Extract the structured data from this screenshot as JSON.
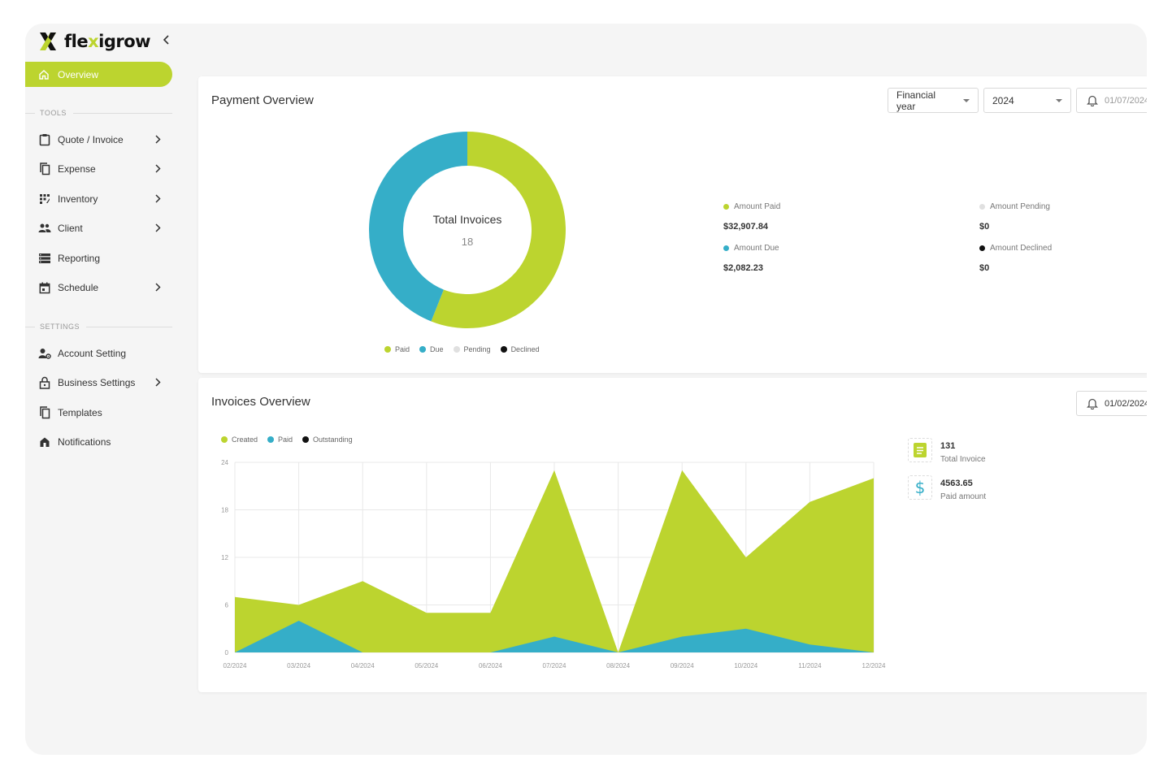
{
  "brand": {
    "name_prefix": "fle",
    "name_x": "x",
    "name_suffix": "igrow",
    "color": "#bcd42f"
  },
  "sidebar": {
    "active": {
      "label": "Overview",
      "icon": "home-icon"
    },
    "tools_heading": "TOOLS",
    "tools": [
      {
        "label": "Quote / Invoice",
        "icon": "clipboard-icon",
        "has_submenu": true
      },
      {
        "label": "Expense",
        "icon": "copy-icon",
        "has_submenu": true
      },
      {
        "label": "Inventory",
        "icon": "grid-icon",
        "has_submenu": true
      },
      {
        "label": "Client",
        "icon": "people-icon",
        "has_submenu": true
      },
      {
        "label": "Reporting",
        "icon": "storage-icon",
        "has_submenu": false
      },
      {
        "label": "Schedule",
        "icon": "calendar-icon",
        "has_submenu": true
      }
    ],
    "settings_heading": "SETTINGS",
    "settings": [
      {
        "label": "Account Setting",
        "icon": "user-gear-icon",
        "has_submenu": false
      },
      {
        "label": "Business Settings",
        "icon": "lock-icon",
        "has_submenu": true
      },
      {
        "label": "Templates",
        "icon": "copy-icon",
        "has_submenu": false
      },
      {
        "label": "Notifications",
        "icon": "home-alert-icon",
        "has_submenu": false
      }
    ]
  },
  "payment_overview": {
    "title": "Payment Overview",
    "period_select": "Financial year",
    "year_select": "2024",
    "date_range": "01/07/2024",
    "donut_center_label": "Total Invoices",
    "donut_center_value": "18",
    "legend": [
      "Paid",
      "Due",
      "Pending",
      "Declined"
    ],
    "stats": {
      "amount_paid_label": "Amount Paid",
      "amount_paid": "$32,907.84",
      "amount_pending_label": "Amount Pending",
      "amount_pending": "$0",
      "amount_due_label": "Amount Due",
      "amount_due": "$2,082.23",
      "amount_declined_label": "Amount Declined",
      "amount_declined": "$0"
    }
  },
  "invoices_overview": {
    "title": "Invoices Overview",
    "date_range": "01/02/2024",
    "legend": [
      "Created",
      "Paid",
      "Outstanding"
    ],
    "kpis": [
      {
        "value": "131",
        "label": "Total Invoice",
        "icon": "document-icon"
      },
      {
        "value": "4563.65",
        "label": "Paid amount",
        "icon": "dollar-icon"
      }
    ]
  },
  "colors": {
    "paid": "#bcd42f",
    "due": "#35aec8",
    "pending": "#e0e0e0",
    "declined": "#111111"
  },
  "chart_data": [
    {
      "type": "pie",
      "labels": [
        "Paid",
        "Due",
        "Pending",
        "Declined"
      ],
      "values": [
        32907.84,
        2082.23,
        0,
        0
      ],
      "display_fractions": [
        0.56,
        0.44,
        0,
        0
      ]
    },
    {
      "type": "area",
      "categories": [
        "02/2024",
        "03/2024",
        "04/2024",
        "05/2024",
        "06/2024",
        "07/2024",
        "08/2024",
        "09/2024",
        "10/2024",
        "11/2024",
        "12/2024"
      ],
      "series": [
        {
          "name": "Created",
          "values": [
            7,
            6,
            9,
            5,
            5,
            23,
            0,
            23,
            12,
            19,
            22
          ]
        },
        {
          "name": "Paid",
          "values": [
            0,
            4,
            0,
            0,
            0,
            2,
            0,
            2,
            3,
            1,
            0
          ]
        },
        {
          "name": "Outstanding",
          "values": [
            0,
            0,
            0,
            0,
            0,
            0,
            0,
            0,
            0,
            0,
            0
          ]
        }
      ],
      "yticks": [
        0,
        6,
        12,
        18,
        24
      ],
      "ylim": [
        0,
        24
      ],
      "grid": true,
      "legend_position": "top-left"
    }
  ]
}
